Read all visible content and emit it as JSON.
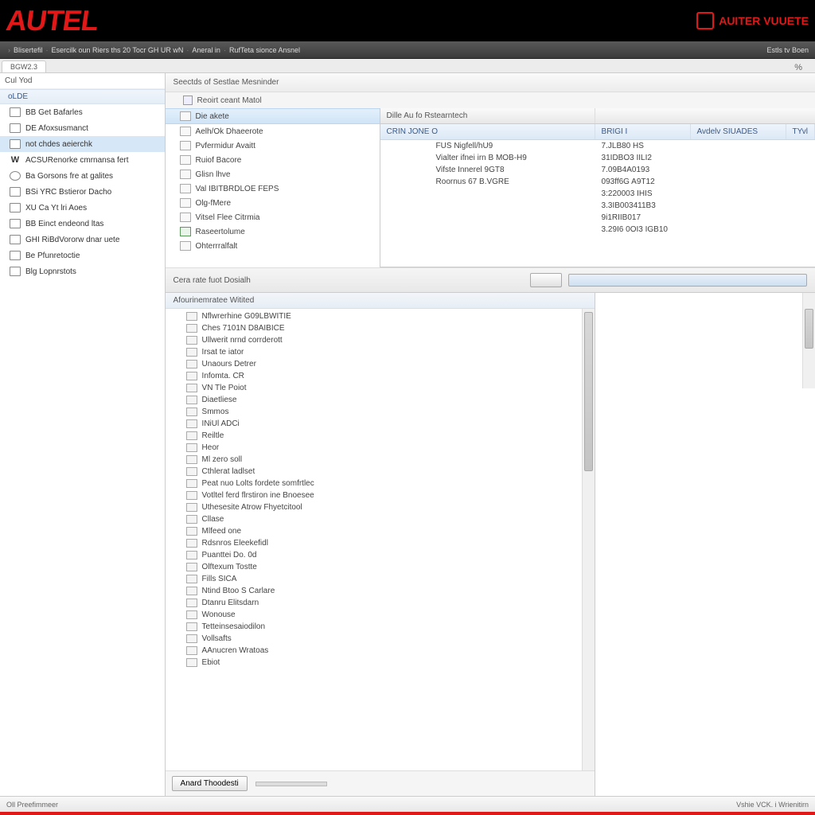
{
  "brand": {
    "main": "AUTEL",
    "right": "AUITER VUUETE"
  },
  "menubar": {
    "items": [
      "Blisertefil",
      "Esercilk oun Riers ths 20 Tocr GH UR wN",
      "Aneral in",
      "RufTeta sionce Ansnel"
    ],
    "right": "Estls tv Boen"
  },
  "tabbar": {
    "active": "BGW2.3",
    "right_icon": "%"
  },
  "sidebar": {
    "header": "Cul Yod",
    "section": "oLDE",
    "items": [
      "BB Get Bafarles",
      "DE Afoxsusmanct",
      "not chdes aeierchk",
      "ACSURenorke cmrnansa fert",
      "Ba Gorsons fre at galites",
      "BSi YRC Bstieror Dacho",
      "XU Ca Yt lri Aoes",
      "BB Einct endeond ltas",
      "GHI RiBdVororw dnar uete",
      "Be Pfunretoctie",
      "Blg Lopnrstots"
    ],
    "icons": [
      "box",
      "box",
      "box",
      "W",
      "gear",
      "box",
      "box",
      "box",
      "box",
      "box",
      "clock"
    ]
  },
  "main": {
    "header": "Seectds of Sestlae Mesninder",
    "sub": "Reoirt ceant Matol"
  },
  "panel_left": [
    "Die akete",
    "Aelh/Ok Dhaeerote",
    "Pvfermidur Avaitt",
    "Ruiof Bacore",
    "Glisn lhve",
    "Val IBITBRDLOE FEPS",
    "Olg-fMere",
    "Vitsel Flee Citrmia",
    "Raseertolume",
    "Ohterrralfalt"
  ],
  "table": {
    "head1": "Dille Au fo Rstearntech",
    "head2_cols": [
      "CRIN JONE O",
      "BRIGI I",
      "Avdelv SIUADES",
      "TYvl"
    ],
    "rows": [
      {
        "name": "FUS Nigfell/hU9",
        "val": "7.JLB80 HS"
      },
      {
        "name": "Vialter ifnei irn B MOB-H9",
        "val": "31IDBO3 IILI2"
      },
      {
        "name": "Vifste Innerel 9GT8",
        "val": "7.09B4A0193"
      },
      {
        "name": "Roornus 67 B.VGRE",
        "val": "093ff6G A9T12"
      },
      {
        "name": "",
        "val": "3:220003 IHIS"
      },
      {
        "name": "",
        "val": "3.3IB003411B3"
      },
      {
        "name": "",
        "val": "9i1RIIB017"
      },
      {
        "name": "",
        "val": "3.29I6 0OI3 IGB10"
      }
    ]
  },
  "detail": {
    "label": "Cera rate fuot Dosialh"
  },
  "lower": {
    "header": "Afourinemratee Witited",
    "items": [
      "Nflwrerhine G09LBWITIE",
      "Ches 7101N D8AIBICE",
      "Ullwerit nrnd corrderott",
      "Irsat te iator",
      "Unaours Detrer",
      "Infomta. CR",
      "VN Tle Poiot",
      "Diaetliese",
      "Smmos",
      "INiUl ADCi",
      "Reiltle",
      "Heor",
      "Ml zero soll",
      "Cthlerat ladlset",
      "Peat nuo Lolts fordete somfrtlec",
      "Votltel ferd flrstiron ine Bnoesee",
      "Uthesesite Atrow Fhyetcitool",
      "Cllase",
      "Mlfeed one",
      "Rdsnros Eleekefidl",
      "Puanttei Do. 0d",
      "Olftexum Tostte",
      "Fills SICA",
      "Ntind Btoo S Carlare",
      "Dtanru Elitsdarn",
      "Wonouse",
      "Tetteinsesaiodilon",
      "Vollsafts",
      "AAnucren Wratoas",
      "Ebiot"
    ],
    "footer_btn": "Anard Thoodesti"
  },
  "statusbar": {
    "left": "Oll Preefimmeer",
    "right": "Vshie VCK. i Wrienitirn"
  }
}
